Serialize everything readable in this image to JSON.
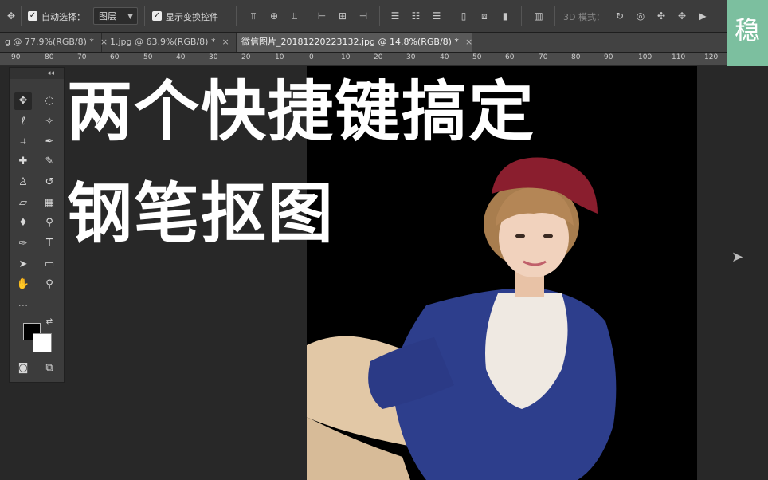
{
  "options_bar": {
    "auto_select_label": "自动选择：",
    "auto_select_value": "图层",
    "show_transform_label": "显示变换控件",
    "mode_3d_label": "3D 模式："
  },
  "tabs": [
    {
      "label": "g @ 77.9%(RGB/8) *",
      "close": "×"
    },
    {
      "label": "1.jpg @ 63.9%(RGB/8) *",
      "close": "×"
    },
    {
      "label": "微信图片_20181220223132.jpg @ 14.8%(RGB/8) *",
      "close": "×"
    }
  ],
  "ruler": {
    "labels": [
      "90",
      "80",
      "70",
      "60",
      "50",
      "40",
      "30",
      "20",
      "10",
      "0",
      "10",
      "20",
      "30",
      "40",
      "50",
      "60",
      "70",
      "80",
      "90",
      "100",
      "110",
      "120"
    ]
  },
  "overlay": {
    "line1": "两个快捷键搞定",
    "line2": "钢笔抠图"
  },
  "brand_char": "稳",
  "colors": {
    "panel": "#3c3c3c",
    "canvas": "#282828",
    "brand": "#7cbf9f",
    "document": "#000000"
  }
}
